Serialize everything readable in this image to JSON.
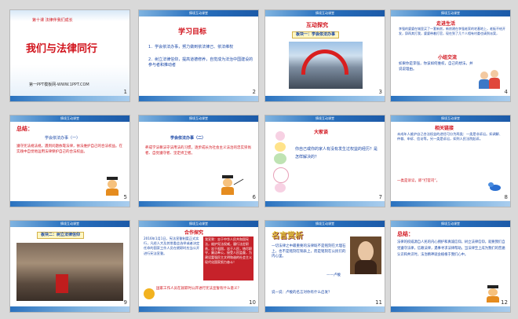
{
  "header_text": "情境互动课堂",
  "slides": [
    {
      "num": "1",
      "kicker": "第十课  法律伴我们成长",
      "title": "我们与法律同行",
      "footer": "第一PPT模板网-WWW.1PPT.COM"
    },
    {
      "num": "2",
      "title": "学习目标",
      "p1": "1．学会依法办事，努力做到依法律己、依法维权",
      "p2": "2．树立法律信仰，提高道德修养，自觉成为法治中国建设的参与者和推动者"
    },
    {
      "num": "3",
      "title": "互动探究",
      "subtitle": "板块一：学会依法办事"
    },
    {
      "num": "4",
      "title": "走进生活",
      "body": "李强的婆婆在城里买了一套新房，新房建在李强老家的宅基地上，老板不给开发，邱再其打我，婆婆带着打官，现在到了几个人相有村委也请到派案，",
      "title2": "小组交流",
      "body2": "如果你是李强，你该如何维权，自己的想法，并说说理由。"
    },
    {
      "num": "5",
      "heading": "总结：",
      "sub": "学会依法办事（一）",
      "body": "遵守宪法规法规，遇到问题依靠法律，依法维护自己的合法权益。在实践中自觉地运用法律保护自己的合法权益。"
    },
    {
      "num": "6",
      "sub": "学会依法办事（二）",
      "body": "养成学法尊法守法用法的习惯，逐步成长为社会主义法治的忠实崇尚者、自觉遵守者、坚定捍卫者。"
    },
    {
      "num": "7",
      "title": "大家谈",
      "body": "你自己或你的家人有没有发生过权益的经历？是怎样解决的？"
    },
    {
      "num": "8",
      "title": "相关链接",
      "body": "未成年人维护自己合法权益的途径可分为两类：一类是非诉讼。如调解、仲裁、申诉、信访等。另一类是诉讼，如到人民法院起诉。",
      "tag": "一类是诉讼，即“打官司”。"
    },
    {
      "num": "9",
      "subtitle": "板块二：树立法律信仰"
    },
    {
      "num": "10",
      "title": "合作探究",
      "body": "2016年1月1日，宪法宣誓制度正式实行，凡经人大及其常委会选举或者决定任命的国家工作人员在就职时应当公开进行宪法宣誓。",
      "side": "我宣誓：忠于中华人民共和国宪法，维护宪法权威，履行法定职责，忠于祖国，忠于人民，恪尽职守，廉洁奉公，接受人民监督，为建设富强民主文明和谐的社会主义现代化国家努力奋斗！",
      "question": "国家工作人员在就职时公开进行宪法宣誓有什么意义？"
    },
    {
      "num": "11",
      "title": "名言赏析",
      "quote": "一切法律之中最重要的法律既不是铭刻在大理石上，也不是铭刻在铜表上，而是铭刻在公民们的内心里。",
      "author": "——卢梭",
      "question": "说一说：卢梭的名言对你有什么启发？"
    },
    {
      "num": "12",
      "heading": "总结：",
      "body": "法律的权威源自人民的内心拥护和真诚信仰。树立法律信仰，就要我们自觉遵守法律，信赖法律，遇事寻求法律帮助。当法律至上成为我们的普遍认识和共识时，法治精神就会植根于我们心中。"
    }
  ]
}
